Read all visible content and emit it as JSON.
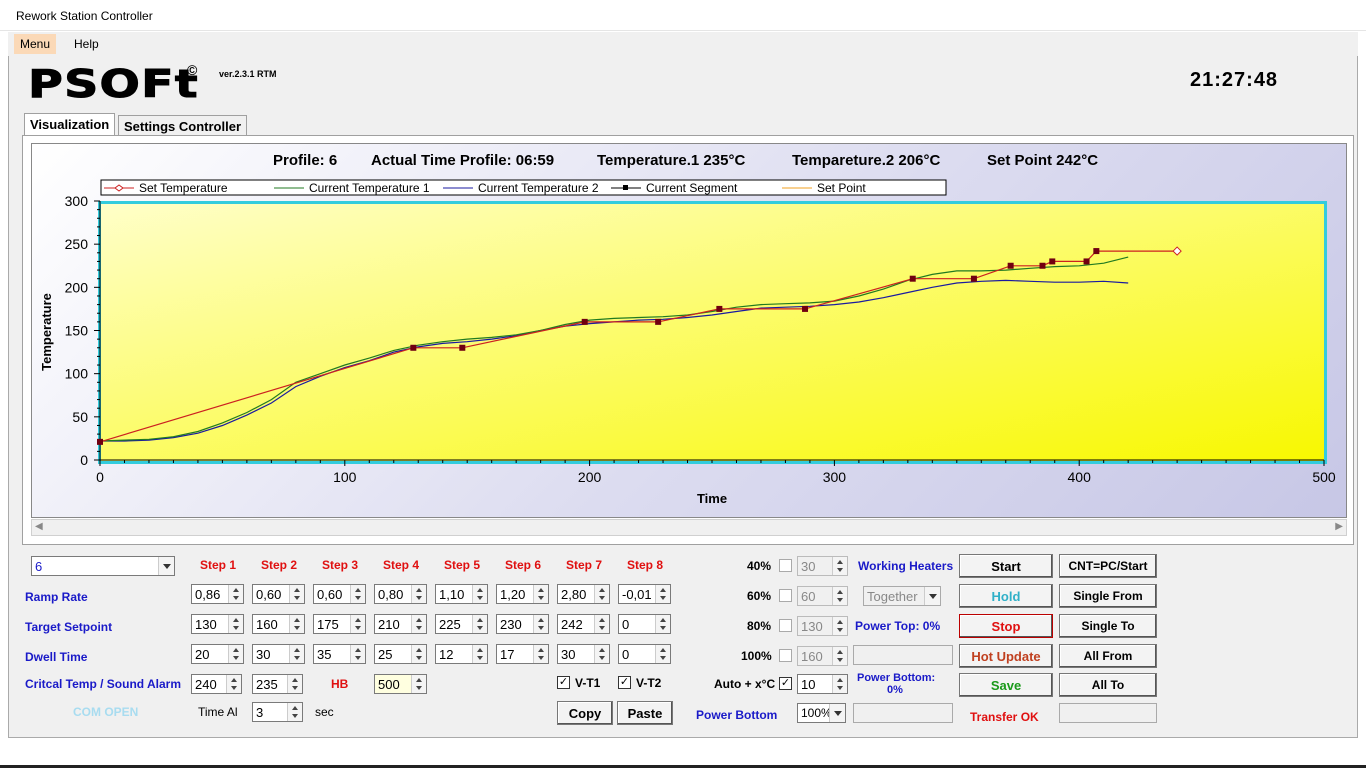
{
  "window": {
    "title": "Rework Station Controller"
  },
  "menu": {
    "items": [
      "Menu",
      "Help"
    ]
  },
  "brand": {
    "logo": "PSOFt",
    "copyright": "©",
    "version": "ver.2.3.1 RTM"
  },
  "clock": "21:27:48",
  "tabs": [
    "Visualization",
    "Settings Controller"
  ],
  "header": {
    "profile": "Profile: 6",
    "actual_time": "Actual Time Profile: 06:59",
    "temp1": "Temperature.1  235°C",
    "temp2": "Tempareture.2  206°C",
    "setpoint": "Set Point 242°C"
  },
  "chart_data": {
    "type": "line",
    "xlabel": "Time",
    "ylabel": "Temperature",
    "xlim": [
      0,
      500
    ],
    "ylim": [
      0,
      300
    ],
    "xticks": [
      0,
      100,
      200,
      300,
      400,
      500
    ],
    "yticks": [
      0,
      50,
      100,
      150,
      200,
      250,
      300
    ],
    "legend": [
      "Set Temperature",
      "Current Temperature 1",
      "Current Temperature 2",
      "Current Segment",
      "Set Point"
    ],
    "legend_position": "top",
    "series": [
      {
        "name": "Set Temperature",
        "color": "#cc2020",
        "points": [
          [
            0,
            21
          ],
          [
            128,
            130
          ],
          [
            148,
            130
          ],
          [
            198,
            160
          ],
          [
            228,
            160
          ],
          [
            253,
            175
          ],
          [
            288,
            175
          ],
          [
            332,
            210
          ],
          [
            357,
            210
          ],
          [
            372,
            225
          ],
          [
            385,
            225
          ],
          [
            389,
            230
          ],
          [
            403,
            230
          ],
          [
            407,
            242
          ],
          [
            440,
            242
          ]
        ]
      },
      {
        "name": "Current Temperature 1",
        "color": "#207a20",
        "points": [
          [
            0,
            22
          ],
          [
            10,
            23
          ],
          [
            20,
            24
          ],
          [
            30,
            27
          ],
          [
            40,
            33
          ],
          [
            50,
            43
          ],
          [
            60,
            55
          ],
          [
            70,
            70
          ],
          [
            80,
            90
          ],
          [
            90,
            100
          ],
          [
            100,
            110
          ],
          [
            110,
            118
          ],
          [
            120,
            127
          ],
          [
            130,
            133
          ],
          [
            140,
            137
          ],
          [
            150,
            140
          ],
          [
            160,
            142
          ],
          [
            170,
            145
          ],
          [
            180,
            150
          ],
          [
            190,
            157
          ],
          [
            200,
            162
          ],
          [
            210,
            164
          ],
          [
            220,
            165
          ],
          [
            230,
            166
          ],
          [
            240,
            168
          ],
          [
            250,
            172
          ],
          [
            260,
            177
          ],
          [
            270,
            180
          ],
          [
            280,
            181
          ],
          [
            290,
            182
          ],
          [
            300,
            184
          ],
          [
            310,
            190
          ],
          [
            320,
            198
          ],
          [
            330,
            208
          ],
          [
            340,
            215
          ],
          [
            350,
            219
          ],
          [
            360,
            219
          ],
          [
            370,
            220
          ],
          [
            380,
            222
          ],
          [
            390,
            224
          ],
          [
            400,
            225
          ],
          [
            410,
            228
          ],
          [
            420,
            235
          ]
        ]
      },
      {
        "name": "Current Temperature 2",
        "color": "#1a1aa0",
        "points": [
          [
            0,
            22
          ],
          [
            10,
            22
          ],
          [
            20,
            23
          ],
          [
            30,
            26
          ],
          [
            40,
            31
          ],
          [
            50,
            40
          ],
          [
            60,
            52
          ],
          [
            70,
            66
          ],
          [
            80,
            85
          ],
          [
            90,
            97
          ],
          [
            100,
            107
          ],
          [
            110,
            115
          ],
          [
            120,
            125
          ],
          [
            130,
            131
          ],
          [
            140,
            135
          ],
          [
            150,
            137
          ],
          [
            160,
            140
          ],
          [
            170,
            144
          ],
          [
            180,
            150
          ],
          [
            190,
            155
          ],
          [
            200,
            158
          ],
          [
            210,
            160
          ],
          [
            220,
            162
          ],
          [
            230,
            163
          ],
          [
            240,
            165
          ],
          [
            250,
            168
          ],
          [
            260,
            172
          ],
          [
            270,
            176
          ],
          [
            280,
            177
          ],
          [
            290,
            178
          ],
          [
            300,
            180
          ],
          [
            310,
            183
          ],
          [
            320,
            188
          ],
          [
            330,
            194
          ],
          [
            340,
            200
          ],
          [
            350,
            205
          ],
          [
            360,
            207
          ],
          [
            370,
            208
          ],
          [
            380,
            207
          ],
          [
            390,
            206
          ],
          [
            400,
            206
          ],
          [
            410,
            207
          ],
          [
            420,
            205
          ]
        ]
      },
      {
        "name": "Current Segment",
        "color": "#700010",
        "points": [
          [
            0,
            21
          ],
          [
            128,
            130
          ],
          [
            148,
            130
          ],
          [
            198,
            160
          ],
          [
            228,
            160
          ],
          [
            253,
            175
          ],
          [
            288,
            175
          ],
          [
            332,
            210
          ],
          [
            357,
            210
          ],
          [
            372,
            225
          ],
          [
            385,
            225
          ],
          [
            389,
            230
          ],
          [
            403,
            230
          ],
          [
            407,
            242
          ]
        ]
      },
      {
        "name": "Set Point",
        "color": "#f0a020",
        "points": []
      }
    ]
  },
  "controls": {
    "profile_select": "6",
    "steps": [
      "Step 1",
      "Step 2",
      "Step 3",
      "Step 4",
      "Step 5",
      "Step 6",
      "Step 7",
      "Step 8"
    ],
    "rows": [
      {
        "label": "Ramp Rate",
        "values": [
          "0,86",
          "0,60",
          "0,60",
          "0,80",
          "1,10",
          "1,20",
          "2,80",
          "-0,01"
        ]
      },
      {
        "label": "Target Setpoint",
        "values": [
          "130",
          "160",
          "175",
          "210",
          "225",
          "230",
          "242",
          "0"
        ]
      },
      {
        "label": "Dwell Time",
        "values": [
          "20",
          "30",
          "35",
          "25",
          "12",
          "17",
          "30",
          "0"
        ]
      }
    ],
    "alarm_label": "Critcal Temp / Sound Alarm",
    "alarm_values": [
      "240",
      "235"
    ],
    "hb_label": "HB",
    "hb_value": "500",
    "vt1": "V-T1",
    "vt2": "V-T2",
    "com_status": "COM OPEN",
    "time_al_label": "Time Al",
    "time_al_value": "3",
    "time_al_unit": "sec",
    "copy": "Copy",
    "paste": "Paste",
    "power_rows": [
      {
        "label": "40%",
        "value": "30"
      },
      {
        "label": "60%",
        "value": "60"
      },
      {
        "label": "80%",
        "value": "130"
      },
      {
        "label": "100%",
        "value": "160"
      }
    ],
    "auto_label": "Auto + x°C",
    "auto_value": "10",
    "power_bottom_label": "Power Bottom",
    "power_bottom_value": "100%",
    "working_heaters": "Working Heaters",
    "heaters_mode": "Together",
    "power_top": "Power Top: 0%",
    "power_bottom_pct_line1": "Power Bottom:",
    "power_bottom_pct_line2": "0%",
    "start": "Start",
    "hold": "Hold",
    "stop": "Stop",
    "hot_update": "Hot Update",
    "save": "Save",
    "transfer_status": "Transfer OK",
    "cnt": "CNT=PC/Start",
    "single_from": "Single From",
    "single_to": "Single To",
    "all_from": "All From",
    "all_to": "All To"
  }
}
